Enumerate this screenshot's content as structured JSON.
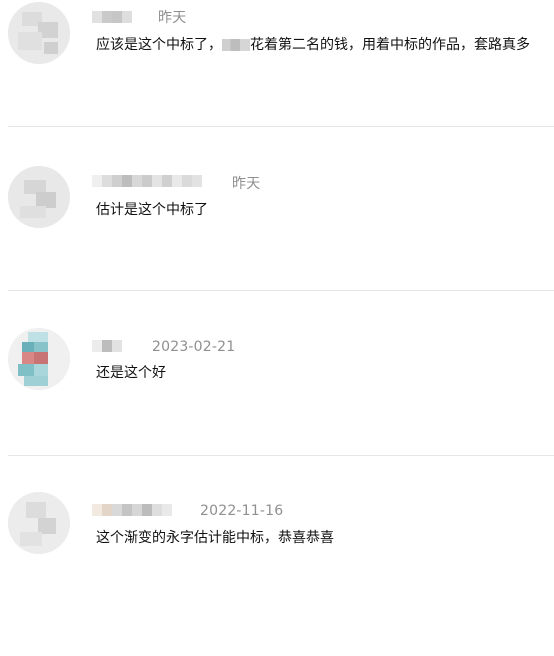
{
  "comments": [
    {
      "date": "昨天",
      "text_parts": [
        "应该是这个中标了，",
        "花着第二名的钱，用着中标的作品，套路真多"
      ]
    },
    {
      "date": "昨天",
      "text": "估计是这个中标了"
    },
    {
      "date": "2023-02-21",
      "text": "还是这个好"
    },
    {
      "date": "2022-11-16",
      "text": "这个渐变的永字估计能中标，恭喜恭喜"
    }
  ]
}
